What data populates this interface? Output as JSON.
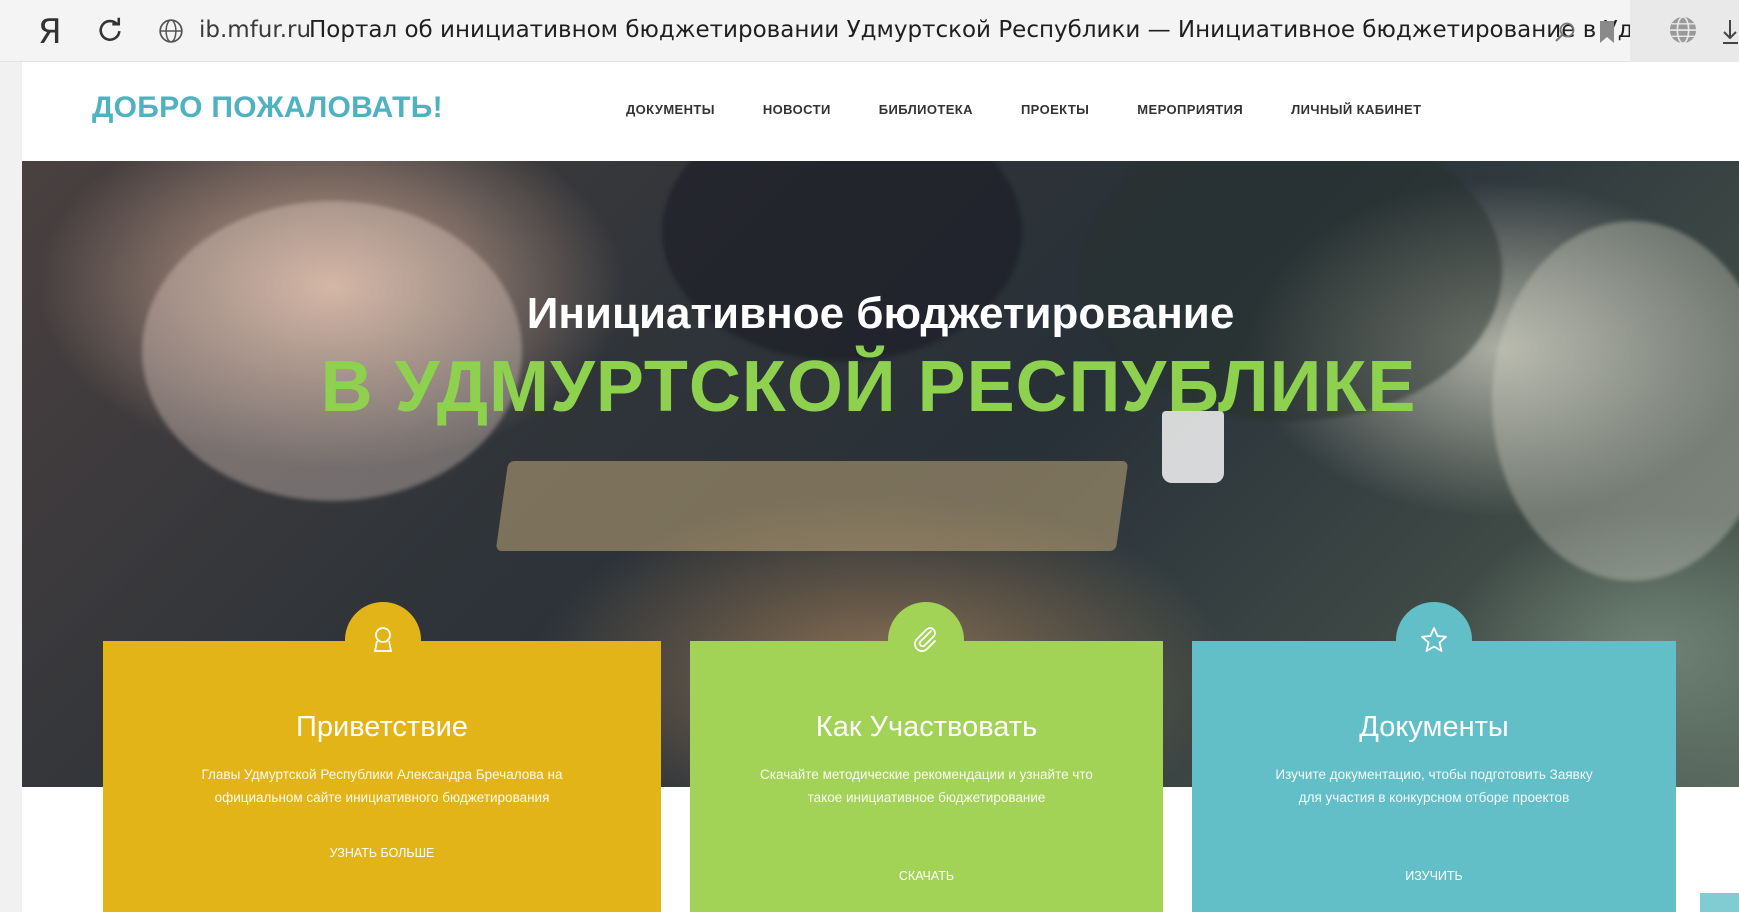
{
  "browser": {
    "logo": "Я",
    "address_domain": "ib.mfur.ru",
    "page_title": "Портал об инициативном бюджетировании Удмуртской Республики — Инициативное бюджетирование в Уд..."
  },
  "header": {
    "logo_text": "ДОБРО ПОЖАЛОВАТЬ!",
    "nav": [
      {
        "label": "ДОКУМЕНТЫ"
      },
      {
        "label": "НОВОСТИ"
      },
      {
        "label": "БИБЛИОТЕКА"
      },
      {
        "label": "ПРОЕКТЫ"
      },
      {
        "label": "МЕРОПРИЯТИЯ"
      },
      {
        "label": "ЛИЧНЫЙ КАБИНЕТ"
      }
    ]
  },
  "hero": {
    "title_line1": "Инициативное бюджетирование",
    "title_line2": "В УДМУРТСКОЙ РЕСПУБЛИКЕ"
  },
  "cards": [
    {
      "icon": "person-icon",
      "title": "Приветствие",
      "text": "Главы Удмуртской Республики Александра Бречалова на официальном сайте инициативного бюджетирования",
      "button": "УЗНАТЬ БОЛЬШЕ"
    },
    {
      "icon": "paperclip-icon",
      "title": "Как Участвовать",
      "text": "Скачайте методические рекомендации и узнайте что такое инициативное бюджетирование",
      "button": "СКАЧАТЬ"
    },
    {
      "icon": "star-icon",
      "title": "Документы",
      "text": "Изучите документацию, чтобы подготовить Заявку для участия в конкурсном отборе проектов",
      "button": "ИЗУЧИТЬ"
    }
  ],
  "colors": {
    "brand_teal": "#4fb2c1",
    "hero_green": "#8ed14f",
    "card_yellow": "#e3b417",
    "card_green": "#a2d256",
    "card_teal": "#62bec7"
  }
}
